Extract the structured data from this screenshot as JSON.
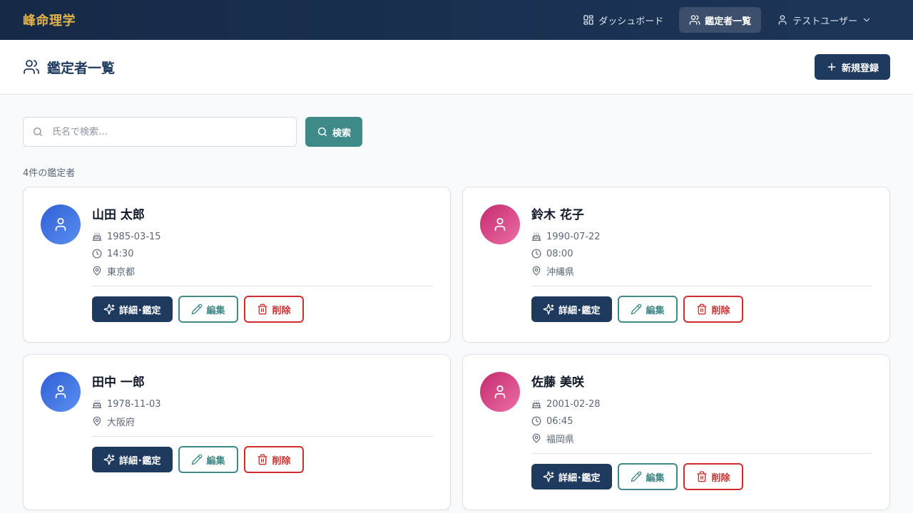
{
  "brand": "峰命理学",
  "nav": {
    "dashboard": "ダッシュボード",
    "clients": "鑑定者一覧",
    "user": "テストユーザー"
  },
  "header": {
    "title": "鑑定者一覧",
    "new_button": "新規登録"
  },
  "search": {
    "placeholder": "氏名で検索…",
    "value": "",
    "button": "検索"
  },
  "result_count": "4件の鑑定者",
  "buttons": {
    "detail": "詳細･鑑定",
    "edit": "編集",
    "delete": "削除"
  },
  "people": [
    {
      "name": "山田 太郎",
      "birthdate": "1985-03-15",
      "time": "14:30",
      "place": "東京都",
      "gender": "male"
    },
    {
      "name": "鈴木 花子",
      "birthdate": "1990-07-22",
      "time": "08:00",
      "place": "沖縄県",
      "gender": "female"
    },
    {
      "name": "田中 一郎",
      "birthdate": "1978-11-03",
      "time": "",
      "place": "大阪府",
      "gender": "male"
    },
    {
      "name": "佐藤 美咲",
      "birthdate": "2001-02-28",
      "time": "06:45",
      "place": "福岡県",
      "gender": "female"
    }
  ],
  "colors": {
    "navy": "#1e3a5f",
    "teal": "#3d8a88",
    "red": "#d22d2d",
    "gold": "#e2b14c"
  }
}
